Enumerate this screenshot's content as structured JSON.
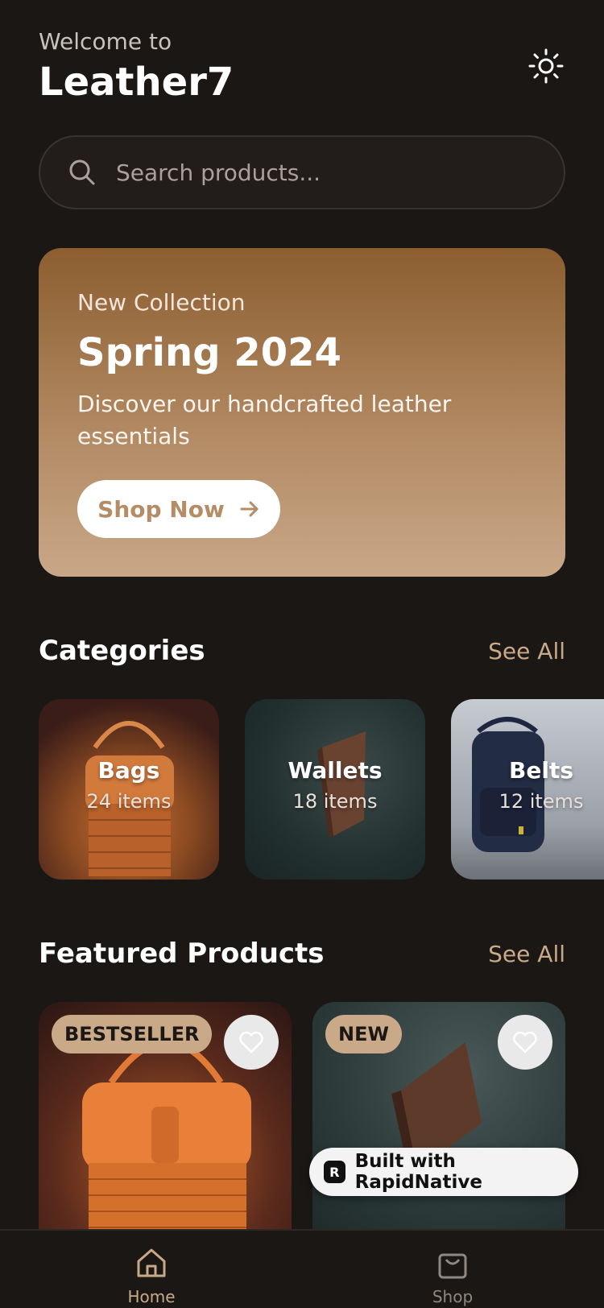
{
  "header": {
    "welcome": "Welcome to",
    "brand": "Leather7"
  },
  "search": {
    "placeholder": "Search products..."
  },
  "hero": {
    "kicker": "New Collection",
    "title": "Spring 2024",
    "description": "Discover our handcrafted leather essentials",
    "button_label": "Shop Now"
  },
  "categories": {
    "title": "Categories",
    "see_all": "See All",
    "items": [
      {
        "name": "Bags",
        "count": "24 items"
      },
      {
        "name": "Wallets",
        "count": "18 items"
      },
      {
        "name": "Belts",
        "count": "12 items"
      }
    ]
  },
  "featured": {
    "title": "Featured Products",
    "see_all": "See All",
    "items": [
      {
        "badge": "BESTSELLER"
      },
      {
        "badge": "NEW"
      }
    ]
  },
  "built_with": "Built with RapidNative",
  "tabs": [
    {
      "label": "Home",
      "icon": "home-icon"
    },
    {
      "label": "Shop",
      "icon": "shopping-bag-icon"
    }
  ],
  "colors": {
    "accent": "#c9a987",
    "background": "#1b1715"
  }
}
